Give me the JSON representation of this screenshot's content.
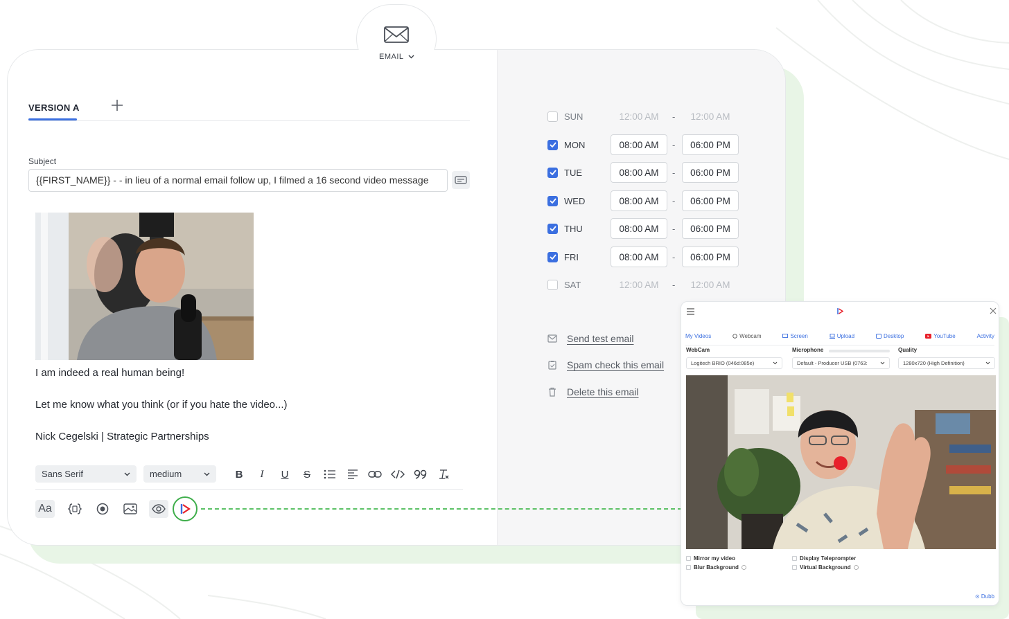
{
  "channel": {
    "label": "EMAIL",
    "icon": "envelope-icon"
  },
  "versions": {
    "active": "VERSION A",
    "add_icon": "plus-icon"
  },
  "subject": {
    "label": "Subject",
    "value": "{{FIRST_NAME}} - - in lieu of a normal email follow up, I filmed a 16 second video message"
  },
  "body": {
    "lines": [
      "I am indeed a real human being!",
      "Let me know what you think (or if you hate the video...)",
      "Nick Cegelski | Strategic Partnerships"
    ]
  },
  "toolbar": {
    "font": "Sans Serif",
    "size": "medium",
    "text_style_label": "Aa"
  },
  "schedule": [
    {
      "day": "SUN",
      "checked": false,
      "start": "12:00 AM",
      "end": "12:00 AM"
    },
    {
      "day": "MON",
      "checked": true,
      "start": "08:00 AM",
      "end": "06:00 PM"
    },
    {
      "day": "TUE",
      "checked": true,
      "start": "08:00 AM",
      "end": "06:00 PM"
    },
    {
      "day": "WED",
      "checked": true,
      "start": "08:00 AM",
      "end": "06:00 PM"
    },
    {
      "day": "THU",
      "checked": true,
      "start": "08:00 AM",
      "end": "06:00 PM"
    },
    {
      "day": "FRI",
      "checked": true,
      "start": "08:00 AM",
      "end": "06:00 PM"
    },
    {
      "day": "SAT",
      "checked": false,
      "start": "12:00 AM",
      "end": "12:00 AM"
    }
  ],
  "schedule_sep": "-",
  "actions": {
    "send_test": "Send test email",
    "spam_check": "Spam check this email",
    "delete": "Delete this email"
  },
  "recorder": {
    "tabs": [
      "My Videos",
      "Webcam",
      "Screen",
      "Upload",
      "Desktop",
      "YouTube",
      "Activity"
    ],
    "webcam_label": "WebCam",
    "webcam_value": "Logitech BRIO (046d:085e)",
    "mic_label": "Microphone",
    "mic_value": "Default - Producer USB (0763:",
    "quality_label": "Quality",
    "quality_value": "1280x720 (High Definition)",
    "options": [
      "Mirror my video",
      "Blur Background",
      "Display Teleprompter",
      "Virtual Background"
    ],
    "brand": "Dubb"
  },
  "colors": {
    "accent": "#3b6fe0",
    "green": "#3fae4b",
    "panel_bg": "#f6f6f7",
    "record_red": "#e8202a"
  }
}
